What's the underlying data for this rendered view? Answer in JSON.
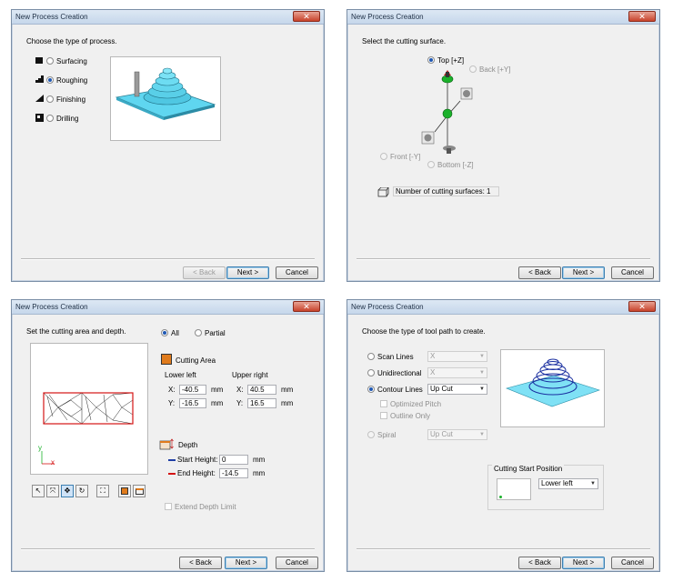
{
  "dialog_title": "New Process Creation",
  "close_glyph": "✕",
  "buttons": {
    "back": "< Back",
    "next": "Next >",
    "cancel": "Cancel"
  },
  "p1": {
    "heading": "Choose the type of process.",
    "options": [
      "Surfacing",
      "Roughing",
      "Finishing",
      "Drilling"
    ],
    "selected": "Roughing"
  },
  "p2": {
    "heading": "Select the cutting surface.",
    "surfaces": {
      "top": "Top [+Z]",
      "back": "Back [+Y]",
      "front": "Front [-Y]",
      "bottom": "Bottom [-Z]"
    },
    "selected": "Top [+Z]",
    "count_label": "Number of cutting surfaces: 1"
  },
  "p3": {
    "heading": "Set the cutting area and depth.",
    "all": "All",
    "partial": "Partial",
    "cutting_area": "Cutting Area",
    "lower_left": "Lower left",
    "upper_right": "Upper right",
    "x": "X:",
    "y": "Y:",
    "ll_x": "-40.5",
    "ll_y": "-16.5",
    "ur_x": "40.5",
    "ur_y": "16.5",
    "mm": "mm",
    "depth": "Depth",
    "start_height_label": "Start Height:",
    "start_height": "0",
    "end_height_label": "End Height:",
    "end_height": "-14.5",
    "extend": "Extend Depth Limit",
    "axis_y": "y",
    "axis_x": "x"
  },
  "p4": {
    "heading": "Choose the type of tool path to create.",
    "scan_lines": "Scan Lines",
    "unidirectional": "Unidirectional",
    "contour_lines": "Contour Lines",
    "optimized_pitch": "Optimized Pitch",
    "outline_only": "Outline Only",
    "spiral": "Spiral",
    "scan_value": "X",
    "uni_value": "X",
    "contour_value": "Up Cut",
    "spiral_value": "Up Cut",
    "start_pos_title": "Cutting Start Position",
    "start_pos_value": "Lower left"
  },
  "colors": {
    "accent": "#1f58b3",
    "preview": "#5fd6f0",
    "area_box": "#d41414",
    "green_ball": "#1bb12b"
  }
}
